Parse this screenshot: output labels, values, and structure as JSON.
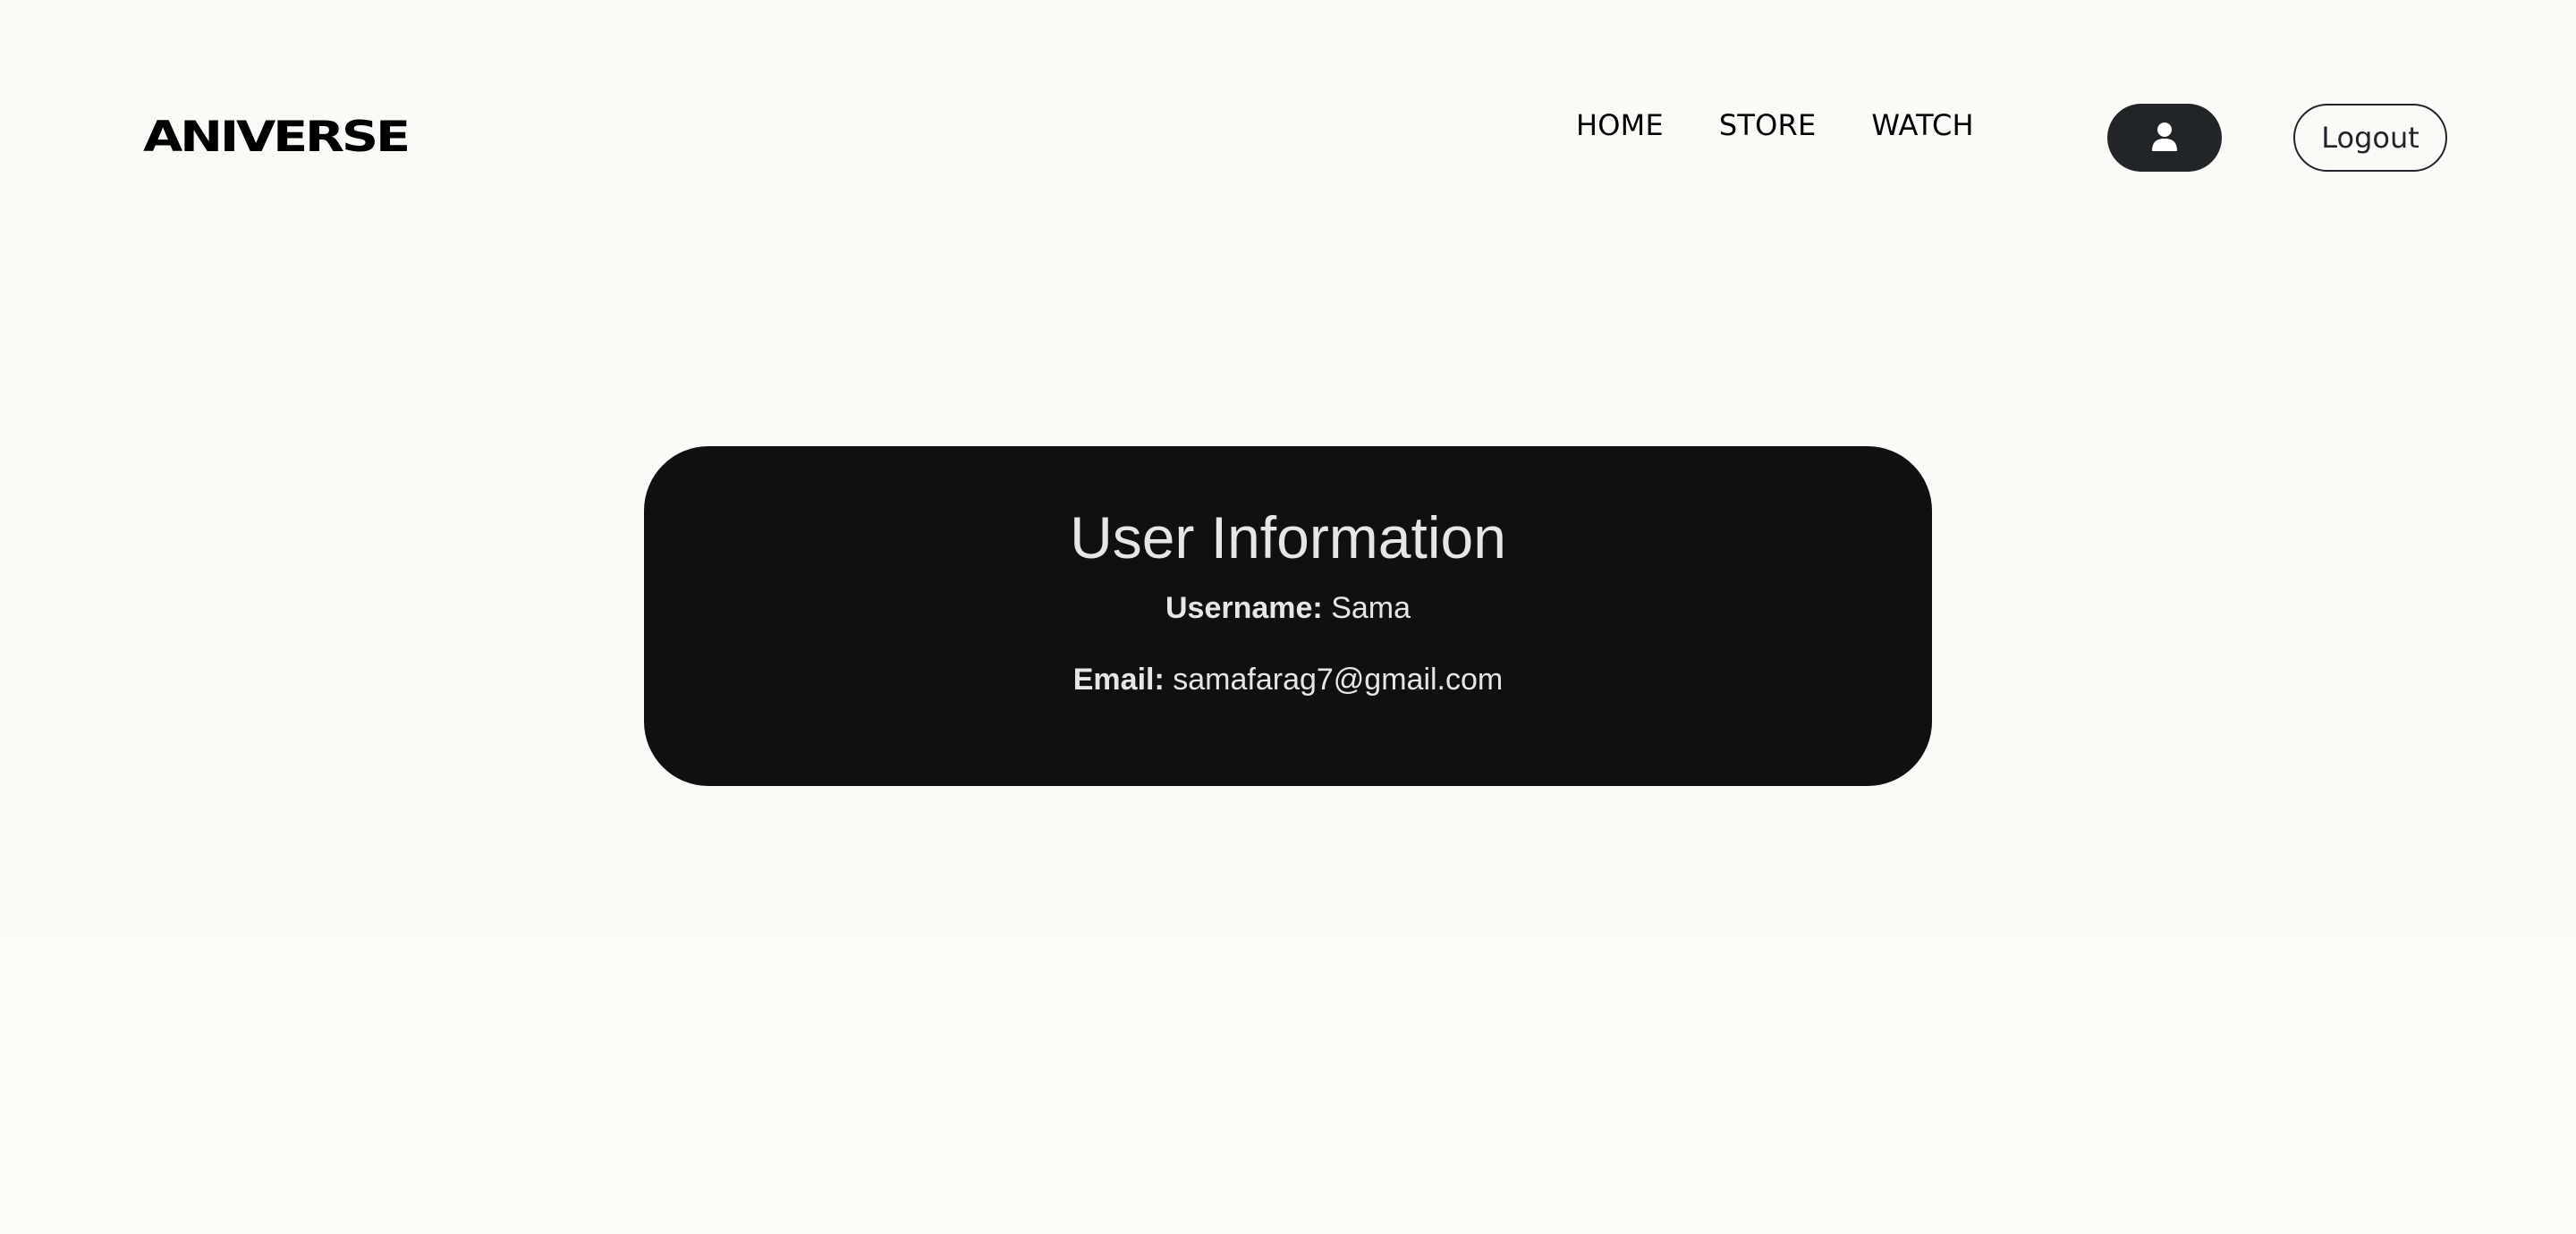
{
  "header": {
    "logo_text": "ANIVERSE",
    "nav": [
      {
        "label": "HOME"
      },
      {
        "label": "STORE"
      },
      {
        "label": "WATCH"
      }
    ],
    "profile_icon": "user-icon",
    "logout_label": "Logout"
  },
  "user_card": {
    "title": "User Information",
    "username_label": "Username:",
    "username_value": "Sama",
    "email_label": "Email:",
    "email_value": "samafarag7@gmail.com"
  },
  "colors": {
    "background": "#fafbf7",
    "card_background": "#0f1110",
    "card_text": "#e6e6e6",
    "button_dark": "#212529"
  }
}
